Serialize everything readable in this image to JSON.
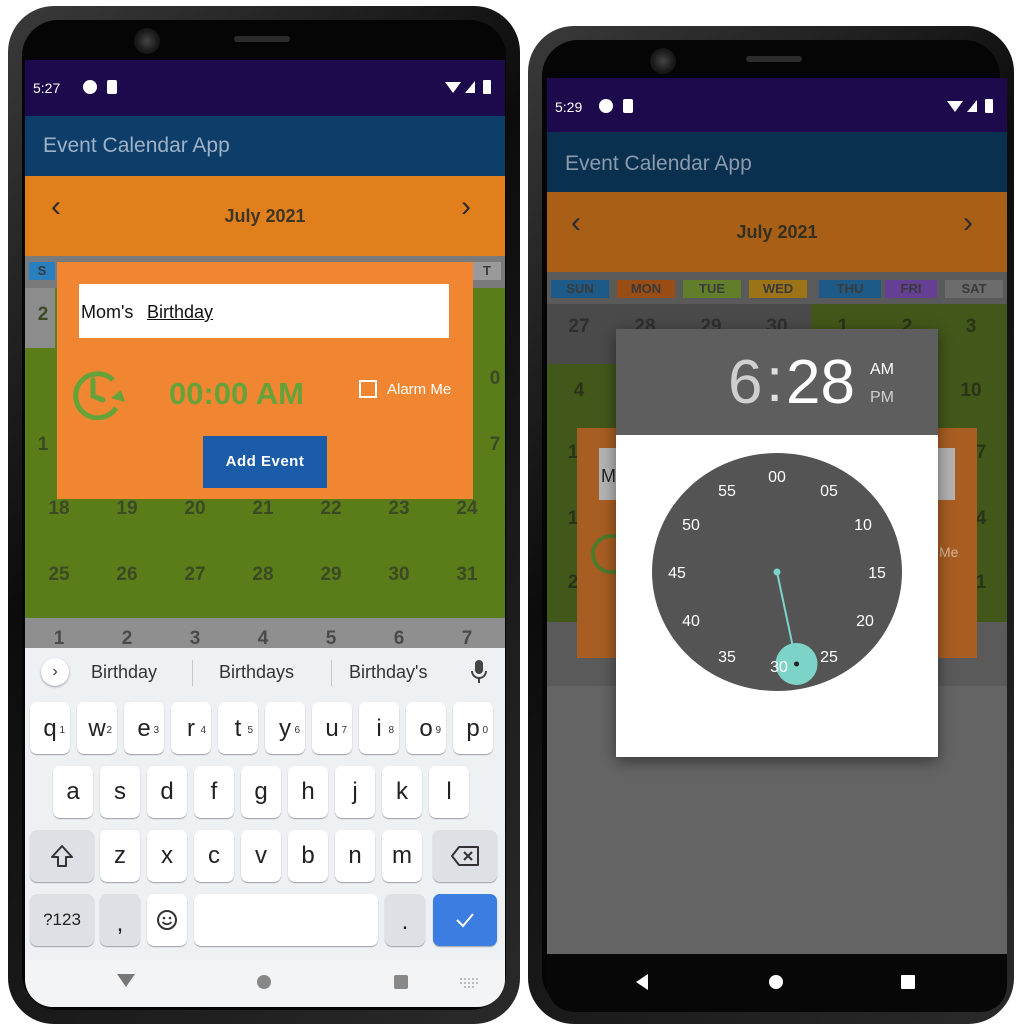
{
  "left_screen": {
    "status": {
      "time": "5:27"
    },
    "app_title": "Event Calendar App",
    "month_label": "July 2021",
    "prev_icon": "chevron-left-icon",
    "next_icon": "chevron-right-icon",
    "partial_day_labels": {
      "left": "S",
      "right": "T"
    },
    "partial_dates": [
      "2",
      "1",
      "1",
      "0",
      "7"
    ],
    "week_rows": [
      [
        "18",
        "19",
        "20",
        "21",
        "22",
        "23",
        "24"
      ],
      [
        "25",
        "26",
        "27",
        "28",
        "29",
        "30",
        "31"
      ],
      [
        "1",
        "2",
        "3",
        "4",
        "5",
        "6",
        "7"
      ]
    ],
    "dialog": {
      "input_value_plain": "Mom's ",
      "input_value_underlined": "Birthday",
      "time_value": "00:00 AM",
      "alarm_label": "Alarm Me",
      "add_button": "Add Event"
    },
    "keyboard": {
      "suggestions": [
        "Birthday",
        "Birthdays",
        "Birthday's"
      ],
      "row1": [
        {
          "k": "q",
          "n": "1"
        },
        {
          "k": "w",
          "n": "2"
        },
        {
          "k": "e",
          "n": "3"
        },
        {
          "k": "r",
          "n": "4"
        },
        {
          "k": "t",
          "n": "5"
        },
        {
          "k": "y",
          "n": "6"
        },
        {
          "k": "u",
          "n": "7"
        },
        {
          "k": "i",
          "n": "8"
        },
        {
          "k": "o",
          "n": "9"
        },
        {
          "k": "p",
          "n": "0"
        }
      ],
      "row2": [
        "a",
        "s",
        "d",
        "f",
        "g",
        "h",
        "j",
        "k",
        "l"
      ],
      "row3": [
        "z",
        "x",
        "c",
        "v",
        "b",
        "n",
        "m"
      ],
      "symbols_key": "?123",
      "comma_key": ",",
      "period_key": "."
    }
  },
  "right_screen": {
    "status": {
      "time": "5:29"
    },
    "app_title": "Event Calendar App",
    "month_label": "July 2021",
    "day_headers": [
      "SUN",
      "MON",
      "TUE",
      "WED",
      "THU",
      "FRI",
      "SAT"
    ],
    "day_header_colors": [
      "#2a7fbf",
      "#d7661c",
      "#8bb23a",
      "#e0a21d",
      "#2a7fbf",
      "#8e5bd0",
      "#9a9a9a"
    ],
    "row1": [
      "27",
      "28",
      "29",
      "30",
      "1",
      "2",
      "3"
    ],
    "partial_dates": [
      "4",
      "10",
      "1",
      "7",
      "1",
      "4",
      "2",
      "1"
    ],
    "dialog_fragments": {
      "input_letter": "M",
      "alarm_tail": "Me"
    },
    "time_picker": {
      "hour": "6",
      "separator": ":",
      "minute": "28",
      "am_label": "AM",
      "pm_label": "PM",
      "clock_numbers": [
        "00",
        "05",
        "10",
        "15",
        "20",
        "25",
        "30",
        "35",
        "40",
        "45",
        "50",
        "55"
      ],
      "selected_minute": 28
    }
  },
  "colors": {
    "status_bar": "#1c0a4d",
    "app_bar": "#0c3e69",
    "month_bar": "#e07f1c",
    "calendar_grid": "#5b7d19",
    "dialog": "#f08631",
    "add_button": "#1b5ca8",
    "time_text": "#66a23a",
    "clock_hand": "#7dd3c8",
    "keyboard_enter": "#3b7de0"
  }
}
